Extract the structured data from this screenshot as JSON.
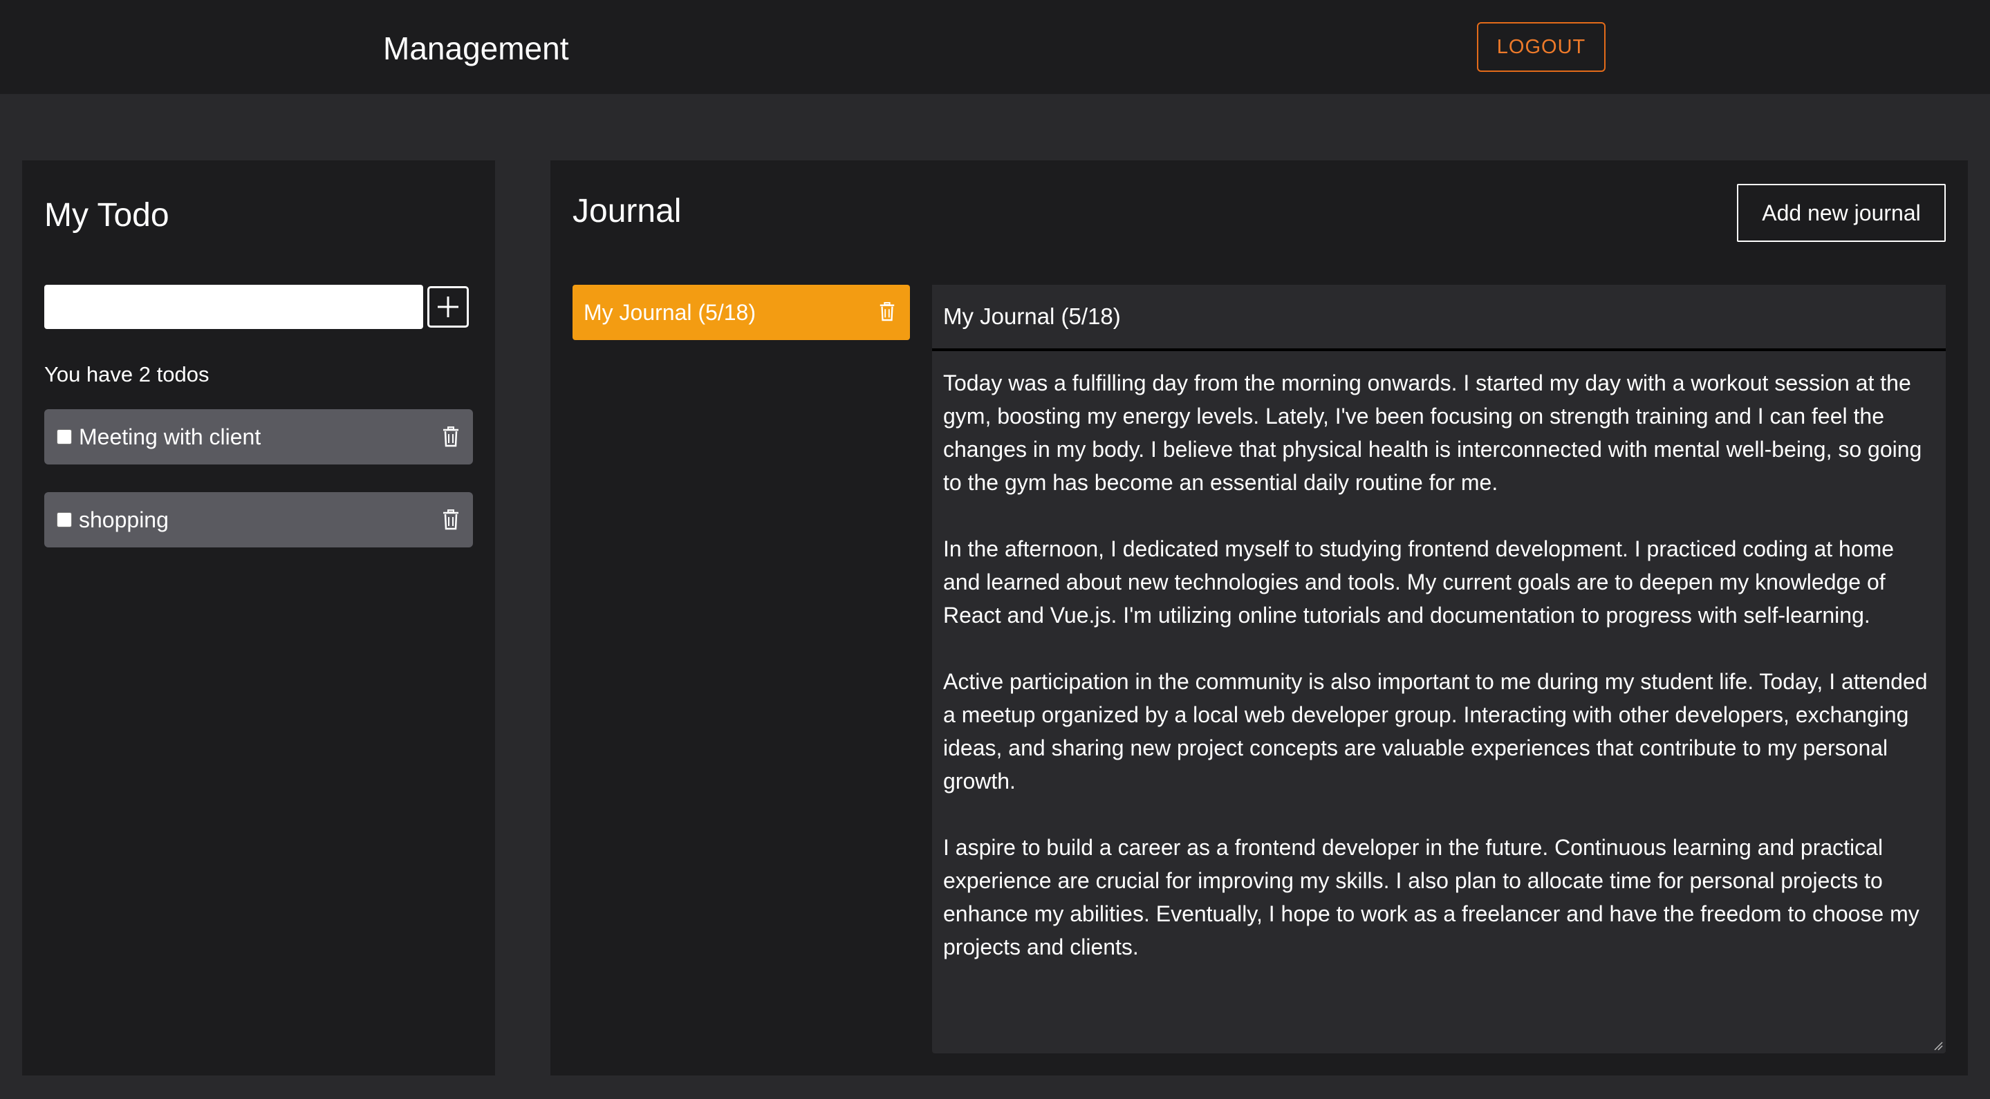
{
  "header": {
    "title": "Management",
    "logout_label": "LOGOUT"
  },
  "todo": {
    "title": "My Todo",
    "input_value": "",
    "add_icon": "plus-icon",
    "count_text": "You have 2 todos",
    "items": [
      {
        "label": "Meeting with client",
        "checked": false
      },
      {
        "label": "shopping",
        "checked": false
      }
    ]
  },
  "journal": {
    "title": "Journal",
    "add_label": "Add new journal",
    "list": [
      {
        "label": "My Journal (5/18)",
        "selected": true
      }
    ],
    "editor": {
      "title_value": "My Journal (5/18)",
      "paragraphs": [
        "Today was a fulfilling day from the morning onwards. I started my day with a workout session at the gym, boosting my energy levels. Lately, I've been focusing on strength training and I can feel the changes in my body. I believe that physical health is interconnected with mental well-being, so going to the gym has become an essential daily routine for me.",
        "In the afternoon, I dedicated myself to studying frontend development. I practiced coding at home and learned about new technologies and tools. My current goals are to deepen my knowledge of React and Vue.js. I'm utilizing online tutorials and documentation to progress with self-learning.",
        "Active participation in the community is also important to me during my student life. Today, I attended a meetup organized by a local web developer group. Interacting with other developers, exchanging ideas, and sharing new project concepts are valuable experiences that contribute to my personal growth.",
        "I aspire to build a career as a frontend developer in the future. Continuous learning and practical experience are crucial for improving my skills. I also plan to allocate time for personal projects to enhance my abilities. Eventually, I hope to work as a freelancer and have the freedom to choose my projects and clients."
      ]
    }
  },
  "colors": {
    "background": "#29292c",
    "panel": "#1c1c1e",
    "accent_orange": "#f39c12",
    "logout_orange": "#ee7a2a",
    "todo_item": "#5a5a60"
  }
}
